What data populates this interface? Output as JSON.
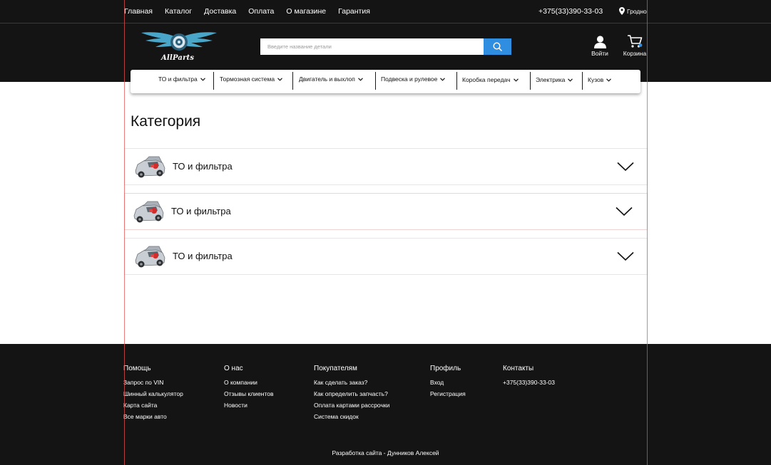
{
  "topbar": {
    "nav": [
      "Главная",
      "Каталог",
      "Доставка",
      "Оплата",
      "О магазине",
      "Гарантия"
    ],
    "phone": "+375(33)390-33-03",
    "city": "Гродно"
  },
  "logo": {
    "text": "AllParts"
  },
  "search": {
    "placeholder": "Введите название детали"
  },
  "actions": {
    "login": "Войти",
    "cart": "Корзина"
  },
  "category_menu": [
    "ТО и фильтра",
    "Тормозная система",
    "Двигатель и выхлоп",
    "Подвеска и рулевое",
    "Коробка передач",
    "Электрика",
    "Кузов"
  ],
  "main": {
    "title": "Категория",
    "items": [
      {
        "label": "ТО и фильтра"
      },
      {
        "label": "ТО и фильтра"
      },
      {
        "label": "ТО и фильтра"
      }
    ]
  },
  "footer": {
    "columns": [
      {
        "title": "Помощь",
        "links": [
          "Запрос по VIN",
          "Шинный калькулятор",
          "Карта сайта",
          "Все марки авто"
        ]
      },
      {
        "title": "О нас",
        "links": [
          "О компании",
          "Отзывы клиентов",
          "Новости"
        ]
      },
      {
        "title": "Покупателям",
        "links": [
          "Как сделать заказ?",
          "Как определить запчасть?",
          "Оплата картами рассрочки",
          "Система скидок"
        ]
      },
      {
        "title": "Профиль",
        "links": [
          "Вход",
          "Регистрация"
        ]
      },
      {
        "title": "Контакты",
        "links": [
          "+375(33)390-33-03"
        ]
      }
    ],
    "copyright": "Разработка сайта - Дунников Алексей"
  },
  "colors": {
    "header_bg": "#141414",
    "accent": "#2f8ee0",
    "logo_wing": "#4aa6c8"
  },
  "icons": [
    "map-pin-icon",
    "search-icon",
    "user-icon",
    "cart-icon",
    "chevron-down-icon",
    "car-icon"
  ]
}
